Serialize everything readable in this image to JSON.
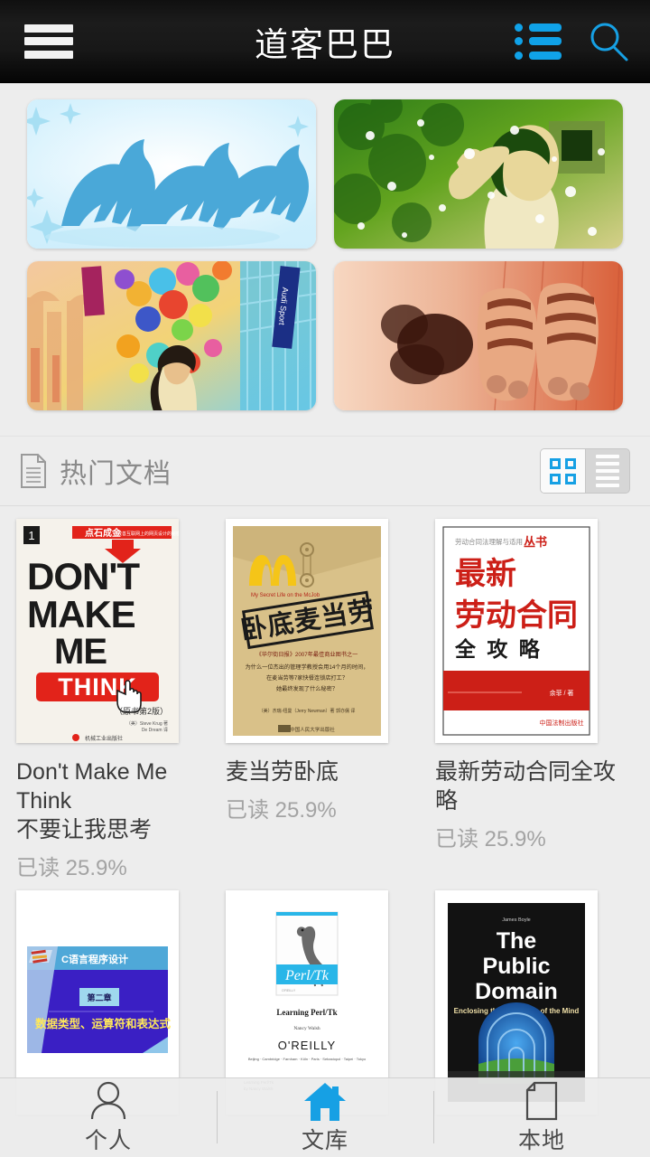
{
  "header": {
    "title": "道客巴巴",
    "menu_icon": "hamburger-menu-icon",
    "list_icon": "list-view-icon",
    "search_icon": "search-icon"
  },
  "banners": [
    {
      "name": "banner-horses",
      "alt": "blue tinted running horses in snow",
      "accent": "#39a9dd"
    },
    {
      "name": "banner-girl-green",
      "alt": "green tinted girl shielding face",
      "accent": "#3f9e2a"
    },
    {
      "name": "banner-balloons",
      "alt": "colorful balloons in shopping mall",
      "accent": "#e8aa2a",
      "sign_text": "Audi Sport"
    },
    {
      "name": "banner-cat-paws",
      "alt": "red tinted cat paws on wood floor",
      "accent": "#d9512c"
    }
  ],
  "section": {
    "icon": "document-icon",
    "title": "热门文档",
    "view_toggle": {
      "grid_label": "grid-view",
      "list_label": "list-view",
      "active": "grid"
    }
  },
  "documents": [
    {
      "title": "Don't Make Me Think",
      "subtitle": "不要让我思考",
      "progress": "已读 25.9%",
      "cover": {
        "name": "cover-dont-make-me-think",
        "bg": "#f4f1ea",
        "badge": "1",
        "band_text": "点石成金",
        "band_sub": "改善互联网上的网页设计的秘密",
        "line1": "DON'T",
        "line2": "MAKE",
        "line3": "ME",
        "line4": "THINK",
        "edition": "（原书第2版）",
        "author1": "Steve Krug",
        "author2": "De Dream",
        "publisher": "机械工业出版社",
        "accent": "#e2231a"
      }
    },
    {
      "title": "麦当劳卧底",
      "subtitle": "",
      "progress": "已读 25.9%",
      "cover": {
        "name": "cover-maidanglao-wodi",
        "bg": "#d9c189",
        "arch_color": "#f5c518",
        "tagline": "My Secret Life on the McJob",
        "stamp": "卧底麦当劳",
        "body1": "《华尔街日报》2007年最佳商业图书之一",
        "body2": "为什么一位杰出的管理学教授会用14个月的时间，",
        "body3": "在麦当劳等7家快餐连锁店打工？",
        "body4": "她最终发现了什么秘密？",
        "authorline": "（美）杰瑞·纽曼（Jerry Newman）著 郭亦儒 译",
        "publisher": "中国人民大学出版社",
        "accent": "#b4261a"
      }
    },
    {
      "title": "最新劳动合同全攻略",
      "subtitle": "",
      "progress": "已读 25.9%",
      "cover": {
        "name": "cover-laodong-hetong",
        "bg": "#ffffff",
        "series_gray": "劳动合同法理解与适用",
        "series_red": "丛书",
        "line1": "最新",
        "line2": "劳动合同",
        "line3": "全 攻 略",
        "author": "余菲 / 著",
        "publisher": "中国法制出版社",
        "accent": "#cc1f17"
      }
    },
    {
      "title": "",
      "subtitle": "",
      "progress": "",
      "cover": {
        "name": "cover-c-language-slide",
        "bg": "#ffffff",
        "header_text": "C语言程序设计",
        "chapter": "第二章",
        "chapter_title": "数据类型、运算符和表达式",
        "accent": "#3a1fc4"
      }
    },
    {
      "title": "",
      "subtitle": "",
      "progress": "",
      "cover": {
        "name": "cover-learning-perl-tk",
        "bg": "#ffffff",
        "band": "Perl/Tk",
        "book_title": "Learning Perl/Tk",
        "author": "Nancy Walsh",
        "brand": "O'REILLY",
        "offices": "Beijing · Cambridge · Farnham · Köln · Paris · Sebastopol · Taipei · Tokyo",
        "footer1": "Learning Perl/Tk",
        "footer2": "by Nancy Walsh",
        "accent": "#29b6e8"
      }
    },
    {
      "title": "",
      "subtitle": "",
      "progress": "",
      "cover": {
        "name": "cover-the-public-domain",
        "bg": "#111111",
        "pretitle": "James Boyle",
        "line1": "The",
        "line2": "Public",
        "line3": "Domain",
        "subtitle_text": "Enclosing the Commons of the Mind",
        "accent": "#1f6fd0"
      }
    }
  ],
  "bottom_nav": [
    {
      "label": "个人",
      "icon": "person-icon",
      "active": false
    },
    {
      "label": "文库",
      "icon": "home-icon",
      "active": true
    },
    {
      "label": "本地",
      "icon": "document-page-icon",
      "active": false
    }
  ],
  "colors": {
    "brand_blue": "#16a0e4",
    "header_bg": "#121212",
    "page_bg": "#ededed",
    "title_text": "#3a3a3a",
    "muted_text": "#a3a3a3"
  }
}
